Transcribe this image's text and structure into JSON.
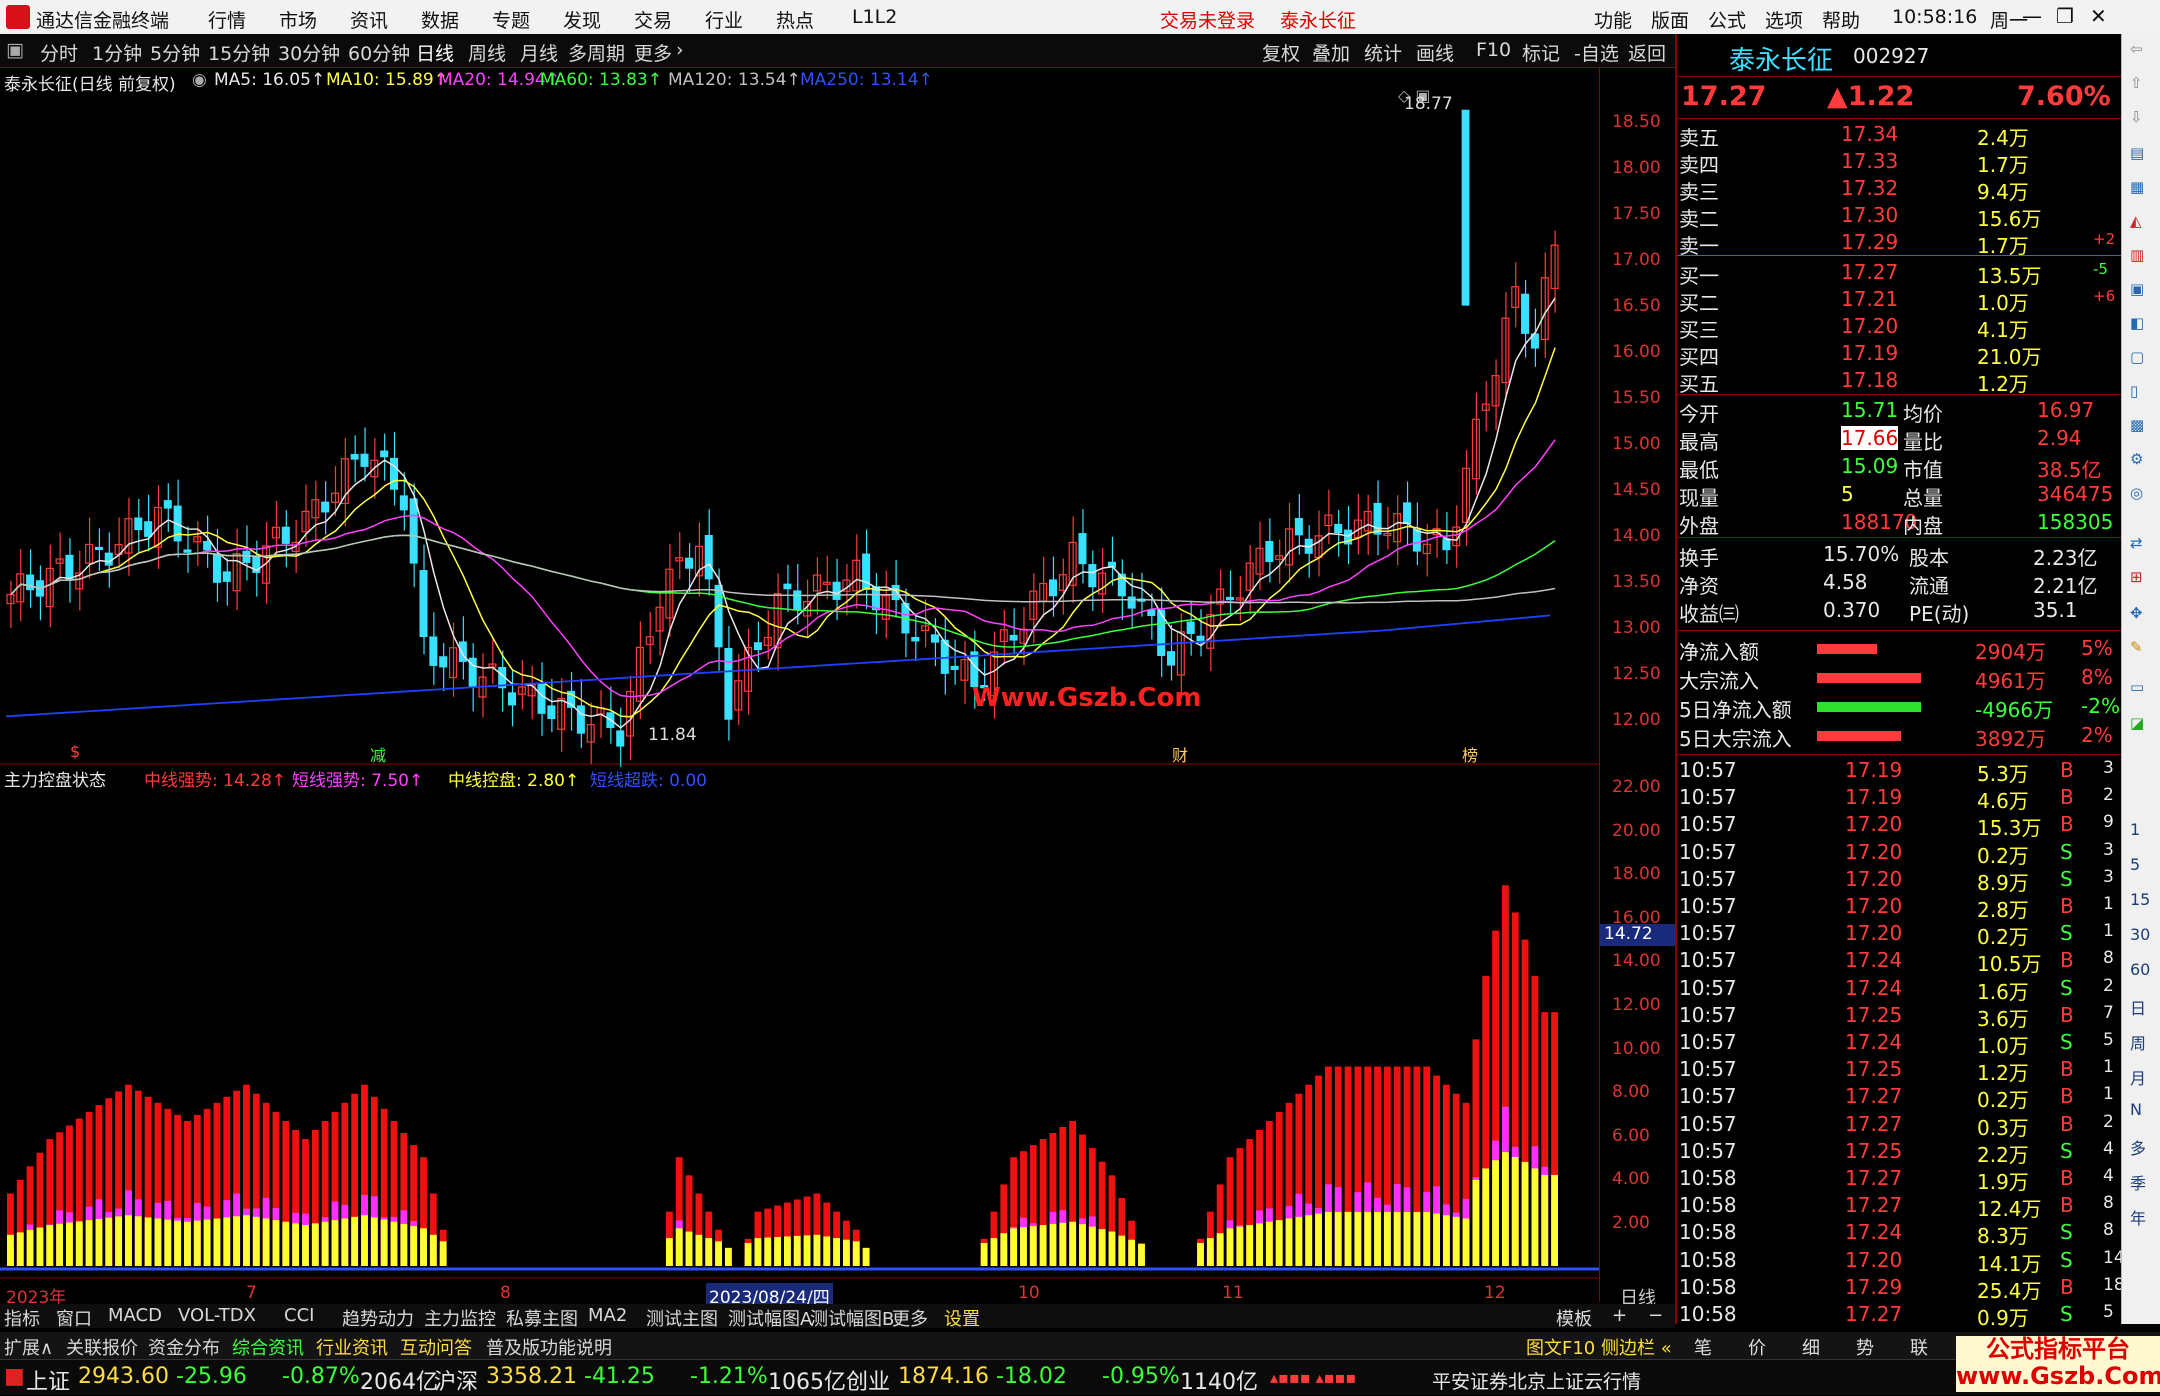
{
  "app": {
    "title": "通达信金融终端",
    "menu": [
      "行情",
      "市场",
      "资讯",
      "数据",
      "专题",
      "发现",
      "交易",
      "行业",
      "热点",
      "L1L2"
    ],
    "login_status": "交易未登录",
    "current_stock": "泰永长征",
    "right_menu": [
      "功能",
      "版面",
      "公式",
      "选项",
      "帮助"
    ],
    "clock": "10:58:16",
    "weekday": "周一"
  },
  "period_toolbar": {
    "items": [
      "分时",
      "1分钟",
      "5分钟",
      "15分钟",
      "30分钟",
      "60分钟",
      "日线",
      "周线",
      "月线",
      "多周期",
      "更多"
    ],
    "selected": "日线",
    "right": [
      "复权",
      "叠加",
      "统计",
      "画线",
      "F10",
      "标记",
      "-自选",
      "返回"
    ]
  },
  "main_chart": {
    "title": "泰永长征(日线 前复权)",
    "indicators": [
      {
        "label": "MA5: 16.05",
        "color": "#e8e8e8"
      },
      {
        "label": "MA10: 15.89",
        "color": "#ffff40"
      },
      {
        "label": "MA20: 14.94",
        "color": "#ff40ff"
      },
      {
        "label": "MA60: 13.83",
        "color": "#3cff3c"
      },
      {
        "label": "MA120: 13.54",
        "color": "#c0c0c0"
      },
      {
        "label": "MA250: 13.14",
        "color": "#3050ff"
      }
    ],
    "y_ticks": [
      "18.50",
      "18.00",
      "17.50",
      "17.00",
      "16.50",
      "16.00",
      "15.50",
      "15.00",
      "14.50",
      "14.00",
      "13.50",
      "13.00",
      "12.50",
      "12.00"
    ],
    "high_label": "18.77",
    "low_label": "11.84",
    "markers": [
      "$",
      "减",
      "财",
      "榜"
    ],
    "watermark": "Www.Gszb.Com"
  },
  "chart_data": [
    {
      "type": "candlestick",
      "title": "泰永长征(日线 前复权)",
      "ylim": [
        11.7,
        18.9
      ],
      "x_labels": [
        "2023年",
        "7",
        "8",
        "2023/08/24/四",
        "10",
        "11",
        "12"
      ],
      "series": [
        {
          "name": "MA5",
          "value": 16.05
        },
        {
          "name": "MA10",
          "value": 15.89
        },
        {
          "name": "MA20",
          "value": 14.94
        },
        {
          "name": "MA60",
          "value": 13.83
        },
        {
          "name": "MA120",
          "value": 13.54
        },
        {
          "name": "MA250",
          "value": 13.14
        }
      ],
      "high": 18.77,
      "low": 11.84,
      "last_close": 17.27
    },
    {
      "type": "bar",
      "title": "主力控盘状态",
      "ylim": [
        0,
        22.5
      ],
      "y_ticks": [
        "22.00",
        "20.00",
        "18.00",
        "16.00",
        "14.00",
        "12.00",
        "10.00",
        "8.00",
        "6.00",
        "4.00",
        "2.00"
      ],
      "current_value_label": "14.72",
      "series": [
        {
          "name": "中线强势",
          "value": 14.28
        },
        {
          "name": "短线强势",
          "value": 7.5
        },
        {
          "name": "中线控盘",
          "value": 2.8
        },
        {
          "name": "短线超跌",
          "value": 0.0
        }
      ]
    }
  ],
  "sub_chart": {
    "title": "主力控盘状态",
    "indicators": [
      {
        "label": "中线强势: 14.28",
        "color": "#ff3b3b"
      },
      {
        "label": "短线强势: 7.50",
        "color": "#ff40ff"
      },
      {
        "label": "中线控盘: 2.80",
        "color": "#ffff40"
      },
      {
        "label": "短线超跌: 0.00",
        "color": "#3050ff"
      }
    ],
    "cur_label": "14.72",
    "period_label": "日线"
  },
  "x_axis": [
    "2023年",
    "7",
    "8",
    "2023/08/24/四",
    "10",
    "11",
    "12"
  ],
  "quote": {
    "name": "泰永长征",
    "code": "002927",
    "price": "17.27",
    "change": "▲1.22",
    "pct": "7.60%",
    "asks": [
      [
        "卖五",
        "17.34",
        "2.4万",
        ""
      ],
      [
        "卖四",
        "17.33",
        "1.7万",
        ""
      ],
      [
        "卖三",
        "17.32",
        "9.4万",
        ""
      ],
      [
        "卖二",
        "17.30",
        "15.6万",
        ""
      ],
      [
        "卖一",
        "17.29",
        "1.7万",
        "+2"
      ]
    ],
    "bids": [
      [
        "买一",
        "17.27",
        "13.5万",
        "-5"
      ],
      [
        "买二",
        "17.21",
        "1.0万",
        "+6"
      ],
      [
        "买三",
        "17.20",
        "4.1万",
        ""
      ],
      [
        "买四",
        "17.19",
        "21.0万",
        ""
      ],
      [
        "买五",
        "17.18",
        "1.2万",
        ""
      ]
    ],
    "stats": [
      [
        "今开",
        "15.71",
        "均价",
        "16.97"
      ],
      [
        "最高",
        "17.66",
        "量比",
        "2.94"
      ],
      [
        "最低",
        "15.09",
        "市值",
        "38.5亿"
      ],
      [
        "现量",
        "5",
        "总量",
        "346475"
      ],
      [
        "外盘",
        "188170",
        "内盘",
        "158305"
      ]
    ],
    "stats2": [
      [
        "换手",
        "15.70%",
        "股本",
        "2.23亿"
      ],
      [
        "净资",
        "4.58",
        "流通",
        "2.21亿"
      ],
      [
        "收益㈢",
        "0.370",
        "PE(动)",
        "35.1"
      ]
    ],
    "flows": [
      [
        "净流入额",
        "2904万",
        "5%"
      ],
      [
        "大宗流入",
        "4961万",
        "8%"
      ],
      [
        "5日净流入额",
        "-4966万",
        "-2%"
      ],
      [
        "5日大宗流入",
        "3892万",
        "2%"
      ]
    ],
    "ticks": [
      [
        "10:57",
        "17.19",
        "5.3万",
        "B",
        "3"
      ],
      [
        "10:57",
        "17.19",
        "4.6万",
        "B",
        "2"
      ],
      [
        "10:57",
        "17.20",
        "15.3万",
        "B",
        "9"
      ],
      [
        "10:57",
        "17.20",
        "0.2万",
        "S",
        "3"
      ],
      [
        "10:57",
        "17.20",
        "8.9万",
        "S",
        "3"
      ],
      [
        "10:57",
        "17.20",
        "2.8万",
        "B",
        "1"
      ],
      [
        "10:57",
        "17.20",
        "0.2万",
        "S",
        "1"
      ],
      [
        "10:57",
        "17.24",
        "10.5万",
        "B",
        "8"
      ],
      [
        "10:57",
        "17.24",
        "1.6万",
        "S",
        "2"
      ],
      [
        "10:57",
        "17.25",
        "3.6万",
        "B",
        "7"
      ],
      [
        "10:57",
        "17.24",
        "1.0万",
        "S",
        "5"
      ],
      [
        "10:57",
        "17.25",
        "1.2万",
        "B",
        "1"
      ],
      [
        "10:57",
        "17.27",
        "0.2万",
        "B",
        "1"
      ],
      [
        "10:57",
        "17.27",
        "0.3万",
        "B",
        "2"
      ],
      [
        "10:57",
        "17.25",
        "2.2万",
        "S",
        "4"
      ],
      [
        "10:58",
        "17.27",
        "1.9万",
        "B",
        "4"
      ],
      [
        "10:58",
        "17.27",
        "12.4万",
        "B",
        "8"
      ],
      [
        "10:58",
        "17.24",
        "8.3万",
        "S",
        "8"
      ],
      [
        "10:58",
        "17.20",
        "14.1万",
        "S",
        "14"
      ],
      [
        "10:58",
        "17.29",
        "25.4万",
        "B",
        "18"
      ],
      [
        "10:58",
        "17.27",
        "0.9万",
        "S",
        "5"
      ]
    ]
  },
  "bottom_tabs": [
    "指标",
    "窗口",
    "MACD",
    "VOL-TDX",
    "CCI",
    "趋势动力",
    "主力监控",
    "私募主图",
    "MA2",
    "测试主图",
    "测试幅图A",
    "测试幅图B",
    "更多",
    "设置"
  ],
  "bottom_right": [
    "模板",
    "日线"
  ],
  "tabs2": {
    "items": [
      "扩展∧",
      "关联报价",
      "资金分布",
      "综合资讯",
      "行业资讯",
      "互动问答",
      "普及版功能说明"
    ],
    "right": "图文F10 侧边栏 «",
    "quote_tabs": [
      "笔",
      "价",
      "细",
      "势",
      "联"
    ]
  },
  "status": {
    "indices": [
      [
        "上证",
        "2943.60",
        "-25.96",
        "-0.87%",
        "2064亿"
      ],
      [
        "沪深",
        "3358.21",
        "-41.25",
        "-1.21%",
        "1065亿"
      ],
      [
        "创业",
        "1874.16",
        "-18.02",
        "-0.95%",
        "1140亿"
      ]
    ],
    "server": "平安证券北京上证云行情"
  },
  "watermark2": {
    "line1": "公式指标平台",
    "line2": "www.Gszb.Com"
  },
  "sidebar": [
    "1",
    "5",
    "15",
    "30",
    "60",
    "日",
    "周",
    "月",
    "N",
    "多",
    "季",
    "年"
  ],
  "colors": {
    "up": "#ff3b3b",
    "down": "#39e0ff",
    "bg": "#000000",
    "grid": "#8b0000"
  }
}
